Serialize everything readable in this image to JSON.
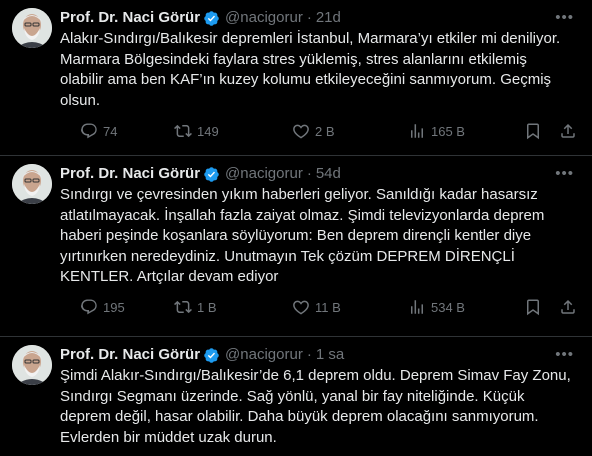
{
  "tweets": [
    {
      "name": "Prof. Dr. Naci Görür",
      "handle": "@nacigorur",
      "time": "21d",
      "lines": [
        "Alakır-Sındırgı/Balıkesir depremleri İstanbul, Marmara’yı etkiler mi deniliyor.",
        "Marmara Bölgesindeki faylara stres yüklemiş, stres alanlarını etkilemiş",
        "olabilir ama ben KAF’ın kuzey kolumu etkileyeceğini sanmıyorum. Geçmiş",
        "olsun."
      ],
      "replies": "74",
      "retweets": "149",
      "likes": "2 B",
      "views": "165 B"
    },
    {
      "name": "Prof. Dr. Naci Görür",
      "handle": "@nacigorur",
      "time": "54d",
      "lines": [
        "Sındırgı ve çevresinden yıkım haberleri geliyor. Sanıldığı kadar hasarsız",
        "atlatılmayacak. İnşallah fazla zaiyat olmaz. Şimdi televizyonlarda deprem",
        "haberi peşinde koşanlara söylüyorum: Ben deprem dirençli kentler diye",
        "yırtınırken neredeydiniz. Unutmayın Tek çözüm DEPREM DİRENÇLİ",
        "KENTLER. Artçılar devam ediyor"
      ],
      "replies": "195",
      "retweets": "1 B",
      "likes": "11 B",
      "views": "534 B"
    },
    {
      "name": "Prof. Dr. Naci Görür",
      "handle": "@nacigorur",
      "time": "1 sa",
      "lines": [
        "Şimdi Alakır-Sındırgı/Balıkesir’de 6,1 deprem oldu. Deprem Simav Fay Zonu,",
        "Sındırgı Segmanı üzerinde. Sağ yönlü, yanal bir fay niteliğinde. Küçük",
        "deprem değil, hasar olabilir. Daha büyük deprem olacağını sanmıyorum.",
        "Evlerden bir müddet uzak durun."
      ]
    }
  ],
  "icons": {
    "verified": "verified-badge-icon",
    "more": "more-icon",
    "reply": "reply-icon",
    "retweet": "retweet-icon",
    "like": "heart-icon",
    "views": "views-icon",
    "bookmark": "bookmark-icon",
    "share": "share-icon"
  },
  "colors": {
    "background": "#000000",
    "text": "#e7e9ea",
    "muted": "#71767b",
    "verified": "#1d9bf0",
    "divider": "#2f3336"
  }
}
